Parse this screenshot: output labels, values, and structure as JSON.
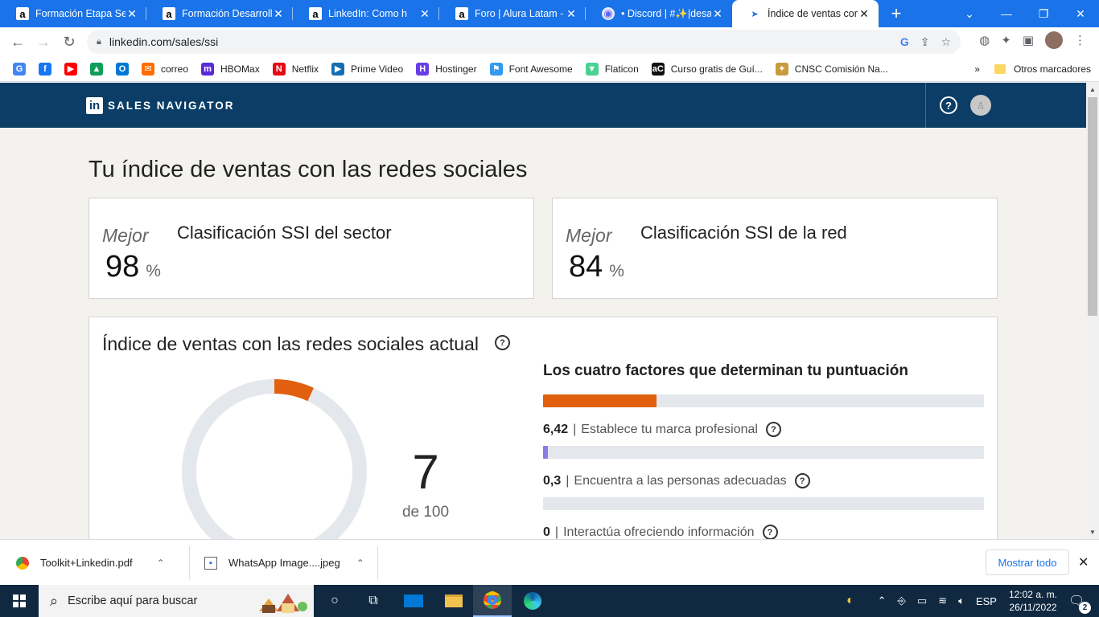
{
  "browser": {
    "tabs": [
      {
        "title": "Formación Etapa Selec",
        "favicon": "alura-icon",
        "active": false
      },
      {
        "title": "Formación Desarrollo",
        "favicon": "alura-icon",
        "active": false
      },
      {
        "title": "LinkedIn: Como h",
        "favicon": "alura-icon",
        "active": false
      },
      {
        "title": "Foro | Alura Latam - C",
        "favicon": "alura-icon",
        "active": false
      },
      {
        "title": "• Discord | #✨|desar",
        "favicon": "discord-icon",
        "active": false
      },
      {
        "title": "Índice de ventas con l",
        "favicon": "compass-icon",
        "active": true
      }
    ],
    "url": "linkedin.com/sales/ssi",
    "bookmarks": [
      {
        "label": "",
        "icon": "google-icon",
        "color": "#4285f4"
      },
      {
        "label": "",
        "icon": "facebook-icon",
        "color": "#1877f2"
      },
      {
        "label": "",
        "icon": "youtube-icon",
        "color": "#ff0000"
      },
      {
        "label": "",
        "icon": "drive-icon",
        "color": "#0f9d58"
      },
      {
        "label": "",
        "icon": "outlook-icon",
        "color": "#0078d4"
      },
      {
        "label": "correo",
        "icon": "mail-icon",
        "color": "#ff6d00"
      },
      {
        "label": "HBOMax",
        "icon": "hbomax-icon",
        "color": "#5b2bd7"
      },
      {
        "label": "Netflix",
        "icon": "netflix-icon",
        "color": "#e50914"
      },
      {
        "label": "Prime Video",
        "icon": "primevideo-icon",
        "color": "#146eb4"
      },
      {
        "label": "Hostinger",
        "icon": "hostinger-icon",
        "color": "#673de6"
      },
      {
        "label": "Font Awesome",
        "icon": "flag-icon",
        "color": "#339af0"
      },
      {
        "label": "Flaticon",
        "icon": "flaticon-icon",
        "color": "#4ad295"
      },
      {
        "label": "Curso gratis de Guí...",
        "icon": "ac-icon",
        "color": "#111111"
      },
      {
        "label": "CNSC Comisión Na...",
        "icon": "cnsc-icon",
        "color": "#c89b3c"
      }
    ],
    "bookmarks_more": "»",
    "other_bookmarks": "Otros marcadores"
  },
  "app": {
    "brand": "SALES NAVIGATOR",
    "brand_badge": "in",
    "help_glyph": "?",
    "accent": "#0b3d66"
  },
  "page": {
    "title": "Tu índice de ventas con las redes sociales",
    "sector_card": {
      "tier": "Mejor",
      "label": "Clasificación SSI del sector",
      "value": "98",
      "unit": "%"
    },
    "network_card": {
      "tier": "Mejor",
      "label": "Clasificación SSI de la red",
      "value": "84",
      "unit": "%"
    },
    "current": {
      "title": "Índice de ventas con las redes sociales actual",
      "score": "7",
      "score_total": "de 100",
      "score_fraction": 0.07,
      "gauge_color": "#e06010"
    },
    "factors_title": "Los cuatro factores que determinan tu puntuación",
    "factors": [
      {
        "value": "6,42",
        "label": "Establece tu marca profesional",
        "fraction": 0.2568,
        "color": "#e06010"
      },
      {
        "value": "0,3",
        "label": "Encuentra a las personas adecuadas",
        "fraction": 0.012,
        "color": "#8c7ae6"
      },
      {
        "value": "0",
        "label": "Interactúa ofreciendo información",
        "fraction": 0,
        "color": "#2f9e9e"
      }
    ]
  },
  "downloads": {
    "items": [
      {
        "name": "Toolkit+Linkedin.pdf",
        "icon": "chrome-icon"
      },
      {
        "name": "WhatsApp Image....jpeg",
        "icon": "file-icon"
      }
    ],
    "show_all": "Mostrar todo"
  },
  "taskbar": {
    "search_placeholder": "Escribe aquí para buscar",
    "language": "ESP",
    "time": "12:02 a. m.",
    "date": "26/11/2022",
    "notifications": "2"
  }
}
